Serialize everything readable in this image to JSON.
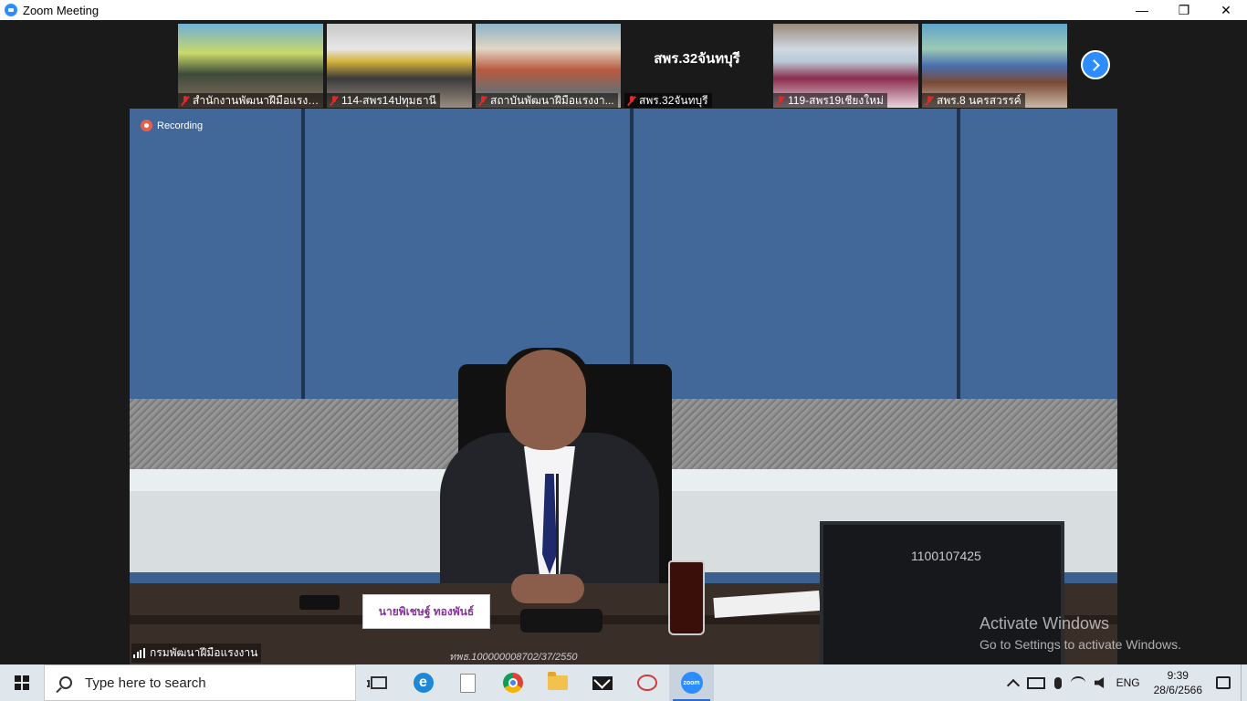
{
  "window": {
    "title": "Zoom Meeting",
    "minimize_label": "—",
    "restore_label": "❐",
    "close_label": "✕"
  },
  "gallery": {
    "thumbnails": [
      {
        "name": "สำนักงานพัฒนาฝีมือแรงง...",
        "muted": true,
        "video": true
      },
      {
        "name": "114-สพร14ปทุมธานี",
        "muted": true,
        "video": true
      },
      {
        "name": "สถาบันพัฒนาฝีมือแรงงา...",
        "muted": true,
        "video": true
      },
      {
        "name": "สพร.32จันทบุรี",
        "muted": true,
        "video": false,
        "center_name": "สพร.32จันทบุรี"
      },
      {
        "name": "119-สพร19เชียงใหม่",
        "muted": true,
        "video": true
      },
      {
        "name": "สพร.8 นครสวรรค์",
        "muted": true,
        "video": true
      }
    ],
    "next_icon": "chevron-right-icon"
  },
  "main_video": {
    "recording_label": "Recording",
    "speaker_name": "กรมพัฒนาฝีมือแรงงาน",
    "nameplate_name": "นายพิเชษฐ์ ทองพันธ์",
    "monitor_code": "1100107425",
    "desk_code": "ทพธ.100000008702/37/2550"
  },
  "watermark": {
    "line1": "Activate Windows",
    "line2": "Go to Settings to activate Windows."
  },
  "taskbar": {
    "search_placeholder": "Type here to search",
    "pinned": [
      "task-view-icon",
      "edge-icon",
      "file-icon",
      "chrome-icon",
      "file-explorer-icon",
      "mail-icon",
      "snip-icon",
      "zoom-icon"
    ],
    "zoom_badge": "zoom",
    "language": "ENG",
    "time": "9:39",
    "date": "28/6/2566"
  }
}
